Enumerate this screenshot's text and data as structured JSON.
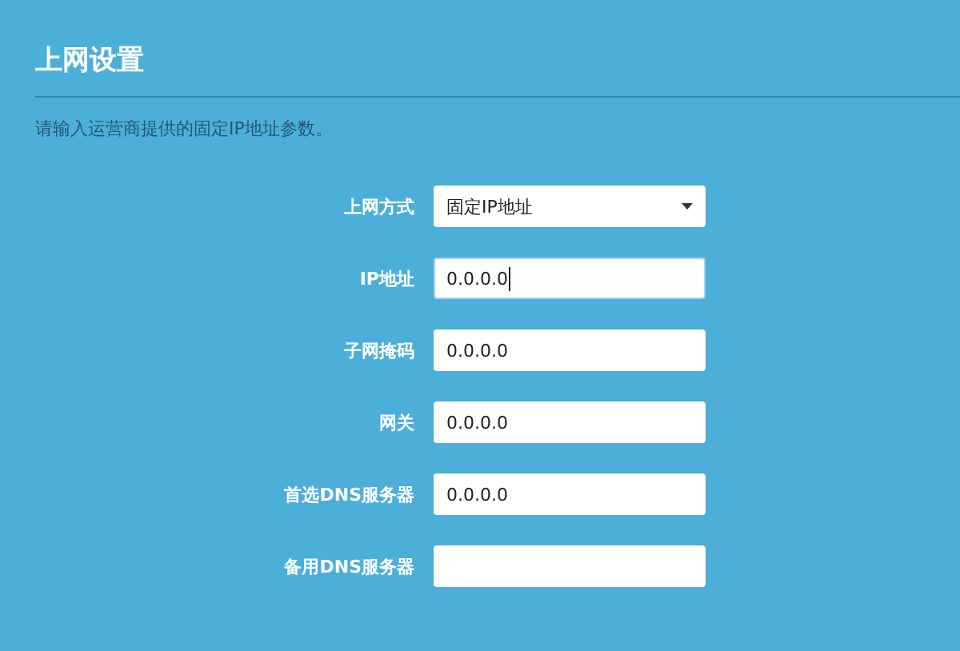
{
  "title": "上网设置",
  "description": "请输入运营商提供的固定IP地址参数。",
  "fields": [
    {
      "label": "上网方式",
      "kind": "select",
      "value": "固定IP地址",
      "focused": false
    },
    {
      "label": "IP地址",
      "kind": "text",
      "value": "0.0.0.0",
      "focused": true
    },
    {
      "label": "子网掩码",
      "kind": "text",
      "value": "0.0.0.0",
      "focused": false
    },
    {
      "label": "网关",
      "kind": "text",
      "value": "0.0.0.0",
      "focused": false
    },
    {
      "label": "首选DNS服务器",
      "kind": "text",
      "value": "0.0.0.0",
      "focused": false
    },
    {
      "label": "备用DNS服务器",
      "kind": "text",
      "focused": false
    }
  ]
}
